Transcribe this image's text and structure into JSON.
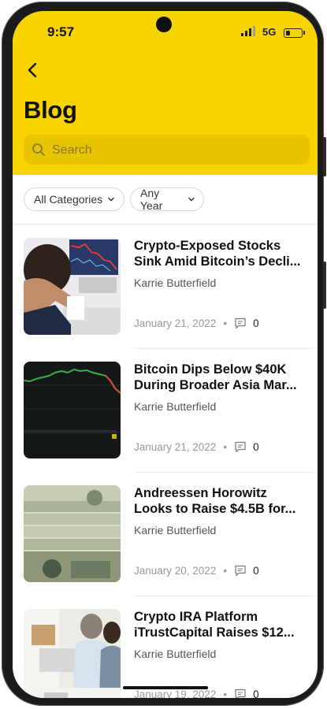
{
  "status_bar": {
    "time": "9:57",
    "network": "5G"
  },
  "header": {
    "title": "Blog",
    "back_icon": "chevron-left-icon"
  },
  "search": {
    "placeholder": "Search",
    "value": ""
  },
  "filters": [
    {
      "label": "All Categories"
    },
    {
      "label": "Any Year"
    }
  ],
  "posts": [
    {
      "title_lines": [
        "Crypto-Exposed Stocks",
        "Sink Amid Bitcoin’s Decli..."
      ],
      "author": "Karrie Butterfield",
      "date": "January 21, 2022",
      "separator": "•",
      "comments": "0"
    },
    {
      "title_lines": [
        "Bitcoin Dips Below $40K",
        "During Broader Asia Mar..."
      ],
      "author": "Karrie Butterfield",
      "date": "January 21, 2022",
      "separator": "•",
      "comments": "0"
    },
    {
      "title_lines": [
        "Andreessen Horowitz",
        "Looks to Raise $4.5B for..."
      ],
      "author": "Karrie Butterfield",
      "date": "January 20, 2022",
      "separator": "•",
      "comments": "0"
    },
    {
      "title_lines": [
        "Crypto IRA Platform",
        "iTrustCapital Raises $12..."
      ],
      "author": "Karrie Butterfield",
      "date": "January 19, 2022",
      "separator": "•",
      "comments": "0"
    }
  ],
  "colors": {
    "brand_yellow": "#f7d300",
    "search_bg": "#e9c400"
  }
}
